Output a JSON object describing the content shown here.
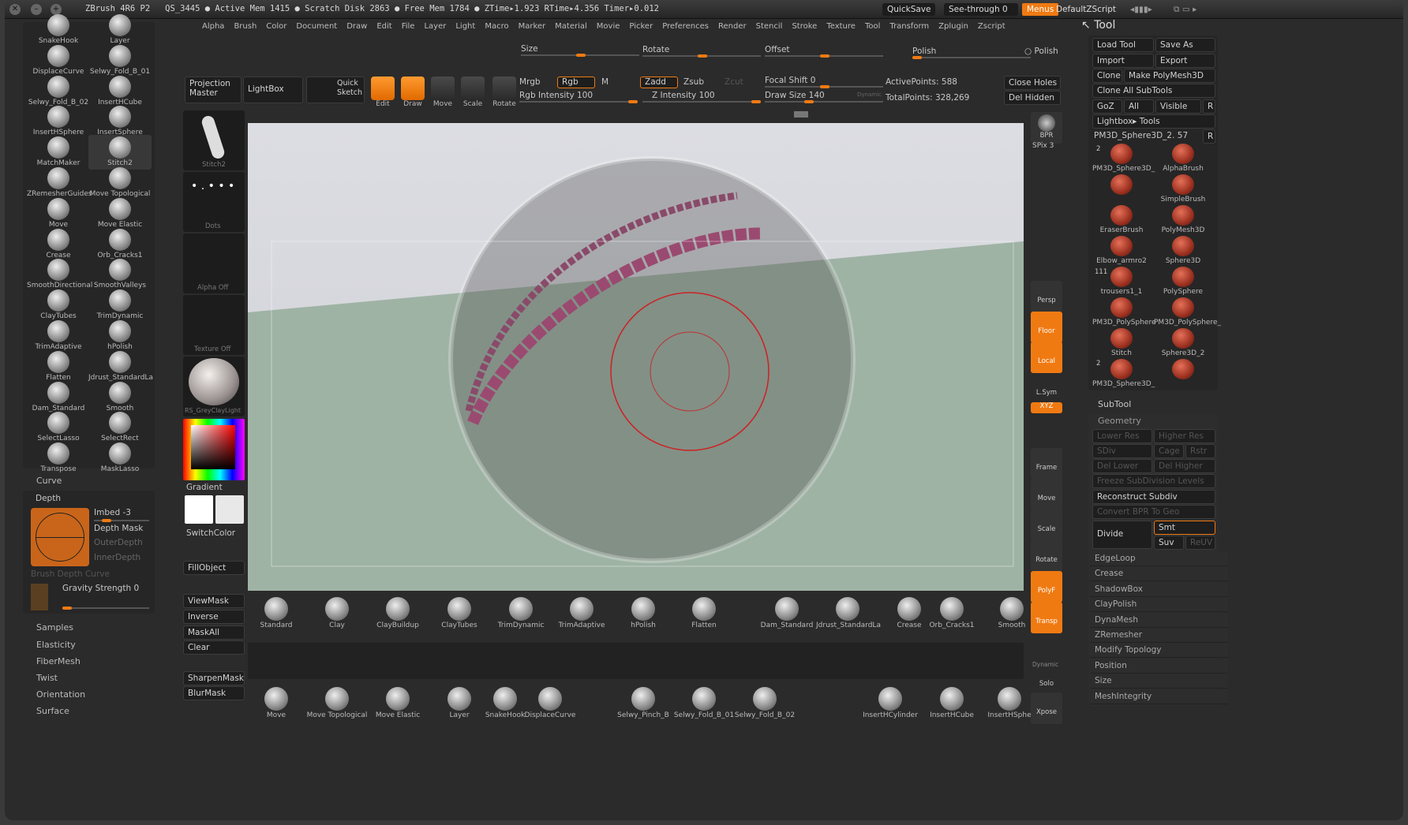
{
  "titlebar": {
    "app": "ZBrush 4R6 P2",
    "status": "QS_3445   ● Active Mem 1415 ● Scratch Disk 2863 ● Free Mem 1784 ● ZTime▸1.923 RTime▸4.356 Timer▸0.012",
    "quicksave": "QuickSave",
    "seethrough": "See-through  0",
    "menus": "Menus",
    "script": "DefaultZScript"
  },
  "menus": [
    "Alpha",
    "Brush",
    "Color",
    "Document",
    "Draw",
    "Edit",
    "File",
    "Layer",
    "Light",
    "Macro",
    "Marker",
    "Material",
    "Movie",
    "Picker",
    "Preferences",
    "Render",
    "Stencil",
    "Stroke",
    "Texture",
    "Tool",
    "Transform",
    "Zplugin",
    "Zscript"
  ],
  "left_brushes": [
    [
      "SnakeHook",
      "Layer"
    ],
    [
      "DisplaceCurve",
      "Selwy_Fold_B_01"
    ],
    [
      "Selwy_Fold_B_02",
      "InsertHCube"
    ],
    [
      "InsertHSphere",
      "InsertSphere"
    ],
    [
      "MatchMaker",
      "Stitch2"
    ],
    [
      "ZRemesherGuides",
      "Move Topological"
    ],
    [
      "Move",
      "Move Elastic"
    ],
    [
      "Crease",
      "Orb_Cracks1"
    ],
    [
      "SmoothDirectional",
      "SmoothValleys"
    ],
    [
      "ClayTubes",
      "TrimDynamic"
    ],
    [
      "TrimAdaptive",
      "hPolish"
    ],
    [
      "Flatten",
      "Jdrust_StandardLa"
    ],
    [
      "Dam_Standard",
      "Smooth"
    ],
    [
      "SelectLasso",
      "SelectRect"
    ],
    [
      "Transpose",
      "MaskLasso"
    ]
  ],
  "left_sections": {
    "curve": "Curve",
    "depth": "Depth",
    "imbed": "Imbed -3",
    "depth_mask": "Depth Mask",
    "outer_depth": "OuterDepth",
    "inner_depth": "InnerDepth",
    "brush_depth_curve": "Brush Depth Curve",
    "gravity": "Gravity Strength 0",
    "samples": "Samples",
    "elasticity": "Elasticity",
    "fibermesh": "FiberMesh",
    "twist": "Twist",
    "orientation": "Orientation",
    "surface": "Surface"
  },
  "shelf": {
    "stroke": "Stitch2",
    "dots": "Dots",
    "alpha": "Alpha Off",
    "texture": "Texture Off",
    "material": "RS_GreyClayLight",
    "gradient": "Gradient",
    "switchcolor": "SwitchColor",
    "fillobject": "FillObject",
    "viewmask": "ViewMask",
    "inverse": "Inverse",
    "maskall": "MaskAll",
    "clear": "Clear",
    "sharpenmask": "SharpenMask",
    "blurmask": "BlurMask"
  },
  "top": {
    "size": "Size",
    "rotate": "Rotate",
    "offset": "Offset",
    "polish_l": "Polish",
    "polish_r": "Polish",
    "projection": "Projection Master",
    "lightbox": "LightBox",
    "quicksketch": "Quick Sketch",
    "edit": "Edit",
    "draw": "Draw",
    "move": "Move",
    "scale": "Scale",
    "rotate_t": "Rotate",
    "mrgb": "Mrgb",
    "rgb": "Rgb",
    "m": "M",
    "rgb_int": "Rgb Intensity 100",
    "zadd": "Zadd",
    "zsub": "Zsub",
    "zcut": "Zcut",
    "z_int": "Z Intensity 100",
    "focal": "Focal Shift 0",
    "drawsize": "Draw Size 140",
    "dynamic": "Dynamic",
    "active": "ActivePoints: 588",
    "total": "TotalPoints: 328,269",
    "close_holes": "Close Holes",
    "del_hidden": "Del Hidden"
  },
  "viewport_tools": {
    "bpr": "BPR",
    "spix": "SPix 3",
    "persp": "Persp",
    "floor": "Floor",
    "local": "Local",
    "lsym": "L.Sym",
    "xyz": "XYZ",
    "frame": "Frame",
    "move": "Move",
    "scale": "Scale",
    "rotate": "Rotate",
    "polyf": "PolyF",
    "transp": "Transp",
    "dynamic": "Dynamic",
    "solo": "Solo",
    "xpose": "Xpose"
  },
  "bottom_brushes_1": [
    "Standard",
    "Clay",
    "ClayBuildup",
    "ClayTubes",
    "TrimDynamic",
    "TrimAdaptive",
    "hPolish",
    "Flatten",
    "Dam_Standard",
    "Jdrust_StandardLa",
    "Crease",
    "Orb_Cracks1",
    "Smooth"
  ],
  "bottom_brushes_2": [
    "Move",
    "Move Topological",
    "Move Elastic",
    "Layer",
    "SnakeHook",
    "DisplaceCurve",
    "Selwy_Pinch_B",
    "Selwy_Fold_B_01",
    "Selwy_Fold_B_02",
    "InsertHCylinder",
    "InsertHCube",
    "InsertHSphe"
  ],
  "tool": {
    "title": "Tool",
    "load": "Load Tool",
    "saveas": "Save As",
    "import": "Import",
    "export": "Export",
    "clone": "Clone",
    "make": "Make PolyMesh3D",
    "cloneall": "Clone All SubTools",
    "goz": "GoZ",
    "all": "All",
    "visible": "Visible",
    "r": "R",
    "lightbox_tools": "Lightbox▸ Tools",
    "current": "PM3D_Sphere3D_2. 57",
    "items": [
      [
        "PM3D_Sphere3D_",
        "AlphaBrush"
      ],
      [
        "",
        "SimpleBrush"
      ],
      [
        "EraserBrush",
        "PolyMesh3D"
      ],
      [
        "Elbow_armro2",
        "Sphere3D"
      ],
      [
        "trousers1_1",
        "PolySphere"
      ],
      [
        "PM3D_PolySphere",
        "PM3D_PolySphere_"
      ],
      [
        "Stitch",
        "Sphere3D_2"
      ],
      [
        "PM3D_Sphere3D_",
        ""
      ]
    ],
    "counts": [
      "2",
      "111",
      "2"
    ],
    "subtool": "SubTool",
    "geometry": "Geometry",
    "lower_res": "Lower Res",
    "higher_res": "Higher Res",
    "sdiv": "SDiv",
    "cage": "Cage",
    "rstr": "Rstr",
    "del_lower": "Del Lower",
    "del_higher": "Del Higher",
    "freeze": "Freeze SubDivision Levels",
    "reconstruct": "Reconstruct Subdiv",
    "convert": "Convert BPR To Geo",
    "divide": "Divide",
    "smt": "Smt",
    "suv": "Suv",
    "reuv": "ReUV",
    "sections": [
      "EdgeLoop",
      "Crease",
      "ShadowBox",
      "ClayPolish",
      "DynaMesh",
      "ZRemesher",
      "Modify Topology",
      "Position",
      "Size",
      "MeshIntegrity"
    ]
  },
  "colors": {
    "accent": "#f07a12",
    "bg": "#2b2b2b",
    "panel": "#262626"
  }
}
